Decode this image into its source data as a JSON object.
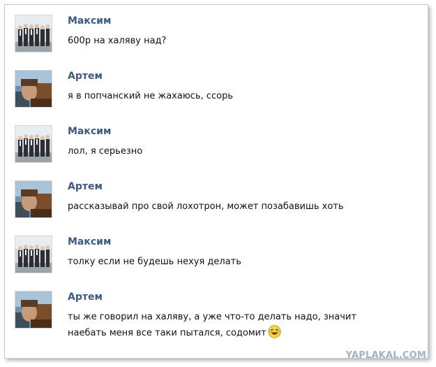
{
  "messages": [
    {
      "author": "Максим",
      "text": "600р на халяву над?",
      "avatar_icon": "group-photo-avatar"
    },
    {
      "author": "Артем",
      "text": "я в попчанский не жахаюсь, ссорь",
      "avatar_icon": "portrait-avatar"
    },
    {
      "author": "Максим",
      "text": "лол, я серьезно",
      "avatar_icon": "group-photo-avatar"
    },
    {
      "author": "Артем",
      "text": "рассказывай про свой лохотрон, может позабавишь хоть",
      "avatar_icon": "portrait-avatar"
    },
    {
      "author": "Максим",
      "text": "толку если не будешь нехуя делать",
      "avatar_icon": "group-photo-avatar"
    },
    {
      "author": "Артем",
      "text_line1": "ты же говорил на халяву, а уже что-то делать надо, значит",
      "text_line2": "наебать меня все таки пытался, содомит",
      "avatar_icon": "portrait-avatar",
      "emoji": "laughing-smiley-icon"
    }
  ],
  "watermark": "YAPLAKAL.COM",
  "colors": {
    "name": "#3b5b80",
    "text": "#111111",
    "watermark": "#9eb3c8"
  }
}
